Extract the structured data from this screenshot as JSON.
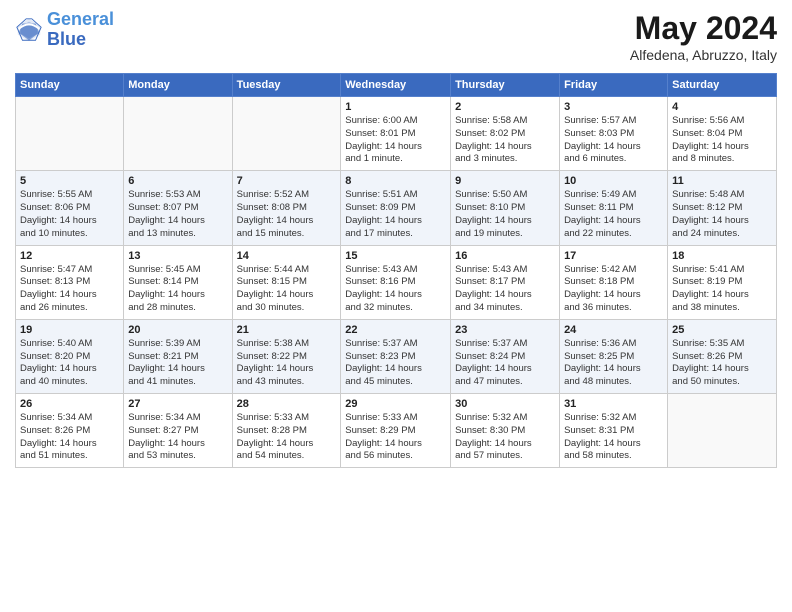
{
  "header": {
    "logo_line1": "General",
    "logo_line2": "Blue",
    "month": "May 2024",
    "location": "Alfedena, Abruzzo, Italy"
  },
  "weekdays": [
    "Sunday",
    "Monday",
    "Tuesday",
    "Wednesday",
    "Thursday",
    "Friday",
    "Saturday"
  ],
  "weeks": [
    [
      {
        "day": "",
        "info": ""
      },
      {
        "day": "",
        "info": ""
      },
      {
        "day": "",
        "info": ""
      },
      {
        "day": "1",
        "info": "Sunrise: 6:00 AM\nSunset: 8:01 PM\nDaylight: 14 hours\nand 1 minute."
      },
      {
        "day": "2",
        "info": "Sunrise: 5:58 AM\nSunset: 8:02 PM\nDaylight: 14 hours\nand 3 minutes."
      },
      {
        "day": "3",
        "info": "Sunrise: 5:57 AM\nSunset: 8:03 PM\nDaylight: 14 hours\nand 6 minutes."
      },
      {
        "day": "4",
        "info": "Sunrise: 5:56 AM\nSunset: 8:04 PM\nDaylight: 14 hours\nand 8 minutes."
      }
    ],
    [
      {
        "day": "5",
        "info": "Sunrise: 5:55 AM\nSunset: 8:06 PM\nDaylight: 14 hours\nand 10 minutes."
      },
      {
        "day": "6",
        "info": "Sunrise: 5:53 AM\nSunset: 8:07 PM\nDaylight: 14 hours\nand 13 minutes."
      },
      {
        "day": "7",
        "info": "Sunrise: 5:52 AM\nSunset: 8:08 PM\nDaylight: 14 hours\nand 15 minutes."
      },
      {
        "day": "8",
        "info": "Sunrise: 5:51 AM\nSunset: 8:09 PM\nDaylight: 14 hours\nand 17 minutes."
      },
      {
        "day": "9",
        "info": "Sunrise: 5:50 AM\nSunset: 8:10 PM\nDaylight: 14 hours\nand 19 minutes."
      },
      {
        "day": "10",
        "info": "Sunrise: 5:49 AM\nSunset: 8:11 PM\nDaylight: 14 hours\nand 22 minutes."
      },
      {
        "day": "11",
        "info": "Sunrise: 5:48 AM\nSunset: 8:12 PM\nDaylight: 14 hours\nand 24 minutes."
      }
    ],
    [
      {
        "day": "12",
        "info": "Sunrise: 5:47 AM\nSunset: 8:13 PM\nDaylight: 14 hours\nand 26 minutes."
      },
      {
        "day": "13",
        "info": "Sunrise: 5:45 AM\nSunset: 8:14 PM\nDaylight: 14 hours\nand 28 minutes."
      },
      {
        "day": "14",
        "info": "Sunrise: 5:44 AM\nSunset: 8:15 PM\nDaylight: 14 hours\nand 30 minutes."
      },
      {
        "day": "15",
        "info": "Sunrise: 5:43 AM\nSunset: 8:16 PM\nDaylight: 14 hours\nand 32 minutes."
      },
      {
        "day": "16",
        "info": "Sunrise: 5:43 AM\nSunset: 8:17 PM\nDaylight: 14 hours\nand 34 minutes."
      },
      {
        "day": "17",
        "info": "Sunrise: 5:42 AM\nSunset: 8:18 PM\nDaylight: 14 hours\nand 36 minutes."
      },
      {
        "day": "18",
        "info": "Sunrise: 5:41 AM\nSunset: 8:19 PM\nDaylight: 14 hours\nand 38 minutes."
      }
    ],
    [
      {
        "day": "19",
        "info": "Sunrise: 5:40 AM\nSunset: 8:20 PM\nDaylight: 14 hours\nand 40 minutes."
      },
      {
        "day": "20",
        "info": "Sunrise: 5:39 AM\nSunset: 8:21 PM\nDaylight: 14 hours\nand 41 minutes."
      },
      {
        "day": "21",
        "info": "Sunrise: 5:38 AM\nSunset: 8:22 PM\nDaylight: 14 hours\nand 43 minutes."
      },
      {
        "day": "22",
        "info": "Sunrise: 5:37 AM\nSunset: 8:23 PM\nDaylight: 14 hours\nand 45 minutes."
      },
      {
        "day": "23",
        "info": "Sunrise: 5:37 AM\nSunset: 8:24 PM\nDaylight: 14 hours\nand 47 minutes."
      },
      {
        "day": "24",
        "info": "Sunrise: 5:36 AM\nSunset: 8:25 PM\nDaylight: 14 hours\nand 48 minutes."
      },
      {
        "day": "25",
        "info": "Sunrise: 5:35 AM\nSunset: 8:26 PM\nDaylight: 14 hours\nand 50 minutes."
      }
    ],
    [
      {
        "day": "26",
        "info": "Sunrise: 5:34 AM\nSunset: 8:26 PM\nDaylight: 14 hours\nand 51 minutes."
      },
      {
        "day": "27",
        "info": "Sunrise: 5:34 AM\nSunset: 8:27 PM\nDaylight: 14 hours\nand 53 minutes."
      },
      {
        "day": "28",
        "info": "Sunrise: 5:33 AM\nSunset: 8:28 PM\nDaylight: 14 hours\nand 54 minutes."
      },
      {
        "day": "29",
        "info": "Sunrise: 5:33 AM\nSunset: 8:29 PM\nDaylight: 14 hours\nand 56 minutes."
      },
      {
        "day": "30",
        "info": "Sunrise: 5:32 AM\nSunset: 8:30 PM\nDaylight: 14 hours\nand 57 minutes."
      },
      {
        "day": "31",
        "info": "Sunrise: 5:32 AM\nSunset: 8:31 PM\nDaylight: 14 hours\nand 58 minutes."
      },
      {
        "day": "",
        "info": ""
      }
    ]
  ]
}
